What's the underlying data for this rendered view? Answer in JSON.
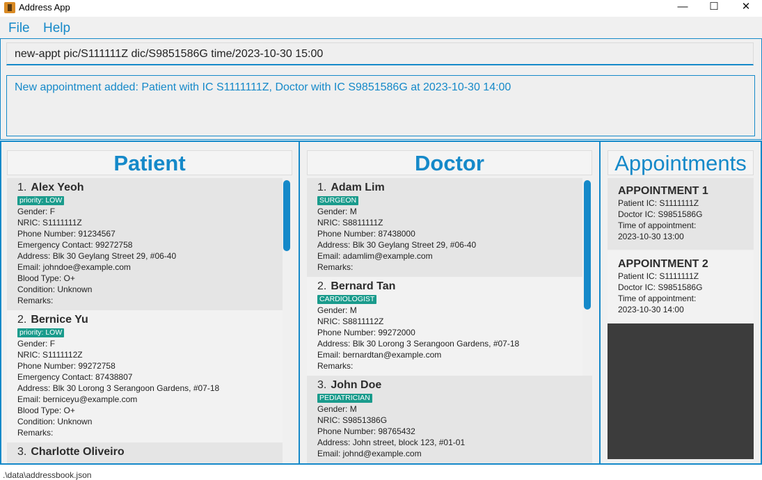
{
  "window": {
    "title": "Address App",
    "controls": {
      "minimize": "—",
      "maximize": "☐",
      "close": "✕"
    }
  },
  "menu": {
    "file": "File",
    "help": "Help"
  },
  "command": {
    "value": "new-appt pic/S111111Z dic/S9851586G time/2023-10-30 15:00"
  },
  "result": {
    "text": "New appointment added: Patient with IC S1111111Z, Doctor with IC S9851586G at 2023-10-30 14:00"
  },
  "patients": {
    "header": "Patient",
    "items": [
      {
        "index": "1.",
        "name": "Alex Yeoh",
        "tag": "priority: LOW",
        "gender": "Gender: F",
        "nric": "NRIC: S1111111Z",
        "phone": "Phone Number: 91234567",
        "emergency": "Emergency Contact: 99272758",
        "address": "Address: Blk 30 Geylang Street 29, #06-40",
        "email": "Email: johndoe@example.com",
        "blood": "Blood Type: O+",
        "condition": "Condition: Unknown",
        "remarks": "Remarks:"
      },
      {
        "index": "2.",
        "name": "Bernice Yu",
        "tag": "priority: LOW",
        "gender": "Gender: F",
        "nric": "NRIC: S1111112Z",
        "phone": "Phone Number: 99272758",
        "emergency": "Emergency Contact: 87438807",
        "address": "Address: Blk 30 Lorong 3 Serangoon Gardens, #07-18",
        "email": "Email: berniceyu@example.com",
        "blood": "Blood Type: O+",
        "condition": "Condition: Unknown",
        "remarks": "Remarks:"
      },
      {
        "index": "3.",
        "name": "Charlotte Oliveiro"
      }
    ]
  },
  "doctors": {
    "header": "Doctor",
    "items": [
      {
        "index": "1.",
        "name": "Adam Lim",
        "tag": "SURGEON",
        "gender": "Gender: M",
        "nric": "NRIC: S8811111Z",
        "phone": "Phone Number: 87438000",
        "address": "Address: Blk 30 Geylang Street 29, #06-40",
        "email": "Email: adamlim@example.com",
        "remarks": "Remarks:"
      },
      {
        "index": "2.",
        "name": "Bernard Tan",
        "tag": "CARDIOLOGIST",
        "gender": "Gender: M",
        "nric": "NRIC: S8811112Z",
        "phone": "Phone Number: 99272000",
        "address": "Address: Blk 30 Lorong 3 Serangoon Gardens, #07-18",
        "email": "Email: bernardtan@example.com",
        "remarks": "Remarks:"
      },
      {
        "index": "3.",
        "name": "John Doe",
        "tag": "PEDIATRICIAN",
        "gender": "Gender: M",
        "nric": "NRIC: S9851386G",
        "phone": "Phone Number: 98765432",
        "address": "Address: John street, block 123, #01-01",
        "email": "Email: johnd@example.com"
      }
    ]
  },
  "appointments": {
    "header": "Appointments",
    "items": [
      {
        "title": "APPOINTMENT 1",
        "patient": "Patient IC: S1111111Z",
        "doctor": "Doctor IC: S9851586G",
        "time_label": "Time of appointment:",
        "time": "2023-10-30 13:00"
      },
      {
        "title": "APPOINTMENT 2",
        "patient": "Patient IC: S1111111Z",
        "doctor": "Doctor IC: S9851586G",
        "time_label": "Time of appointment:",
        "time": "2023-10-30 14:00"
      }
    ]
  },
  "status": {
    "path": ".\\data\\addressbook.json"
  },
  "colors": {
    "accent": "#1589c9",
    "tag": "#1a9b8c"
  }
}
